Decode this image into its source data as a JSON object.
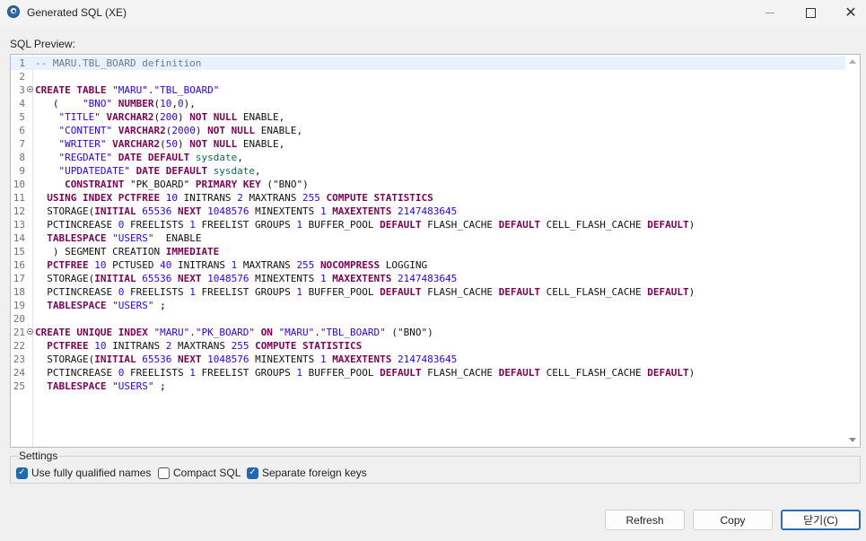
{
  "window": {
    "title": "Generated SQL (XE)"
  },
  "editor": {
    "label": "SQL Preview:",
    "lines": [
      {
        "num": "1",
        "tokens": [
          {
            "t": "-- MARU.TBL_BOARD definition",
            "c": "c"
          }
        ]
      },
      {
        "num": "2",
        "tokens": []
      },
      {
        "num": "3",
        "fold": true,
        "tokens": [
          {
            "t": "CREATE TABLE ",
            "c": "k"
          },
          {
            "t": "\"MARU\"",
            "c": "s"
          },
          {
            "t": ".",
            "c": "t"
          },
          {
            "t": "\"TBL_BOARD\"",
            "c": "s"
          }
        ]
      },
      {
        "num": "4",
        "tokens": [
          {
            "t": "   (    ",
            "c": "t"
          },
          {
            "t": "\"BNO\" ",
            "c": "s"
          },
          {
            "t": "NUMBER",
            "c": "k"
          },
          {
            "t": "(",
            "c": "t"
          },
          {
            "t": "10",
            "c": "n"
          },
          {
            "t": ",",
            "c": "t"
          },
          {
            "t": "0",
            "c": "n"
          },
          {
            "t": "),",
            "c": "t"
          }
        ]
      },
      {
        "num": "5",
        "tokens": [
          {
            "t": "    ",
            "c": "t"
          },
          {
            "t": "\"TITLE\" ",
            "c": "s"
          },
          {
            "t": "VARCHAR2",
            "c": "k"
          },
          {
            "t": "(",
            "c": "t"
          },
          {
            "t": "200",
            "c": "n"
          },
          {
            "t": ") ",
            "c": "t"
          },
          {
            "t": "NOT NULL ",
            "c": "k"
          },
          {
            "t": "ENABLE,",
            "c": "t"
          }
        ]
      },
      {
        "num": "6",
        "tokens": [
          {
            "t": "    ",
            "c": "t"
          },
          {
            "t": "\"CONTENT\" ",
            "c": "s"
          },
          {
            "t": "VARCHAR2",
            "c": "k"
          },
          {
            "t": "(",
            "c": "t"
          },
          {
            "t": "2000",
            "c": "n"
          },
          {
            "t": ") ",
            "c": "t"
          },
          {
            "t": "NOT NULL ",
            "c": "k"
          },
          {
            "t": "ENABLE,",
            "c": "t"
          }
        ]
      },
      {
        "num": "7",
        "tokens": [
          {
            "t": "    ",
            "c": "t"
          },
          {
            "t": "\"WRITER\" ",
            "c": "s"
          },
          {
            "t": "VARCHAR2",
            "c": "k"
          },
          {
            "t": "(",
            "c": "t"
          },
          {
            "t": "50",
            "c": "n"
          },
          {
            "t": ") ",
            "c": "t"
          },
          {
            "t": "NOT NULL ",
            "c": "k"
          },
          {
            "t": "ENABLE,",
            "c": "t"
          }
        ]
      },
      {
        "num": "8",
        "tokens": [
          {
            "t": "    ",
            "c": "t"
          },
          {
            "t": "\"REGDATE\" ",
            "c": "s"
          },
          {
            "t": "DATE DEFAULT ",
            "c": "k"
          },
          {
            "t": "sysdate",
            "c": "f"
          },
          {
            "t": ",",
            "c": "t"
          }
        ]
      },
      {
        "num": "9",
        "tokens": [
          {
            "t": "    ",
            "c": "t"
          },
          {
            "t": "\"UPDATEDATE\" ",
            "c": "s"
          },
          {
            "t": "DATE DEFAULT ",
            "c": "k"
          },
          {
            "t": "sysdate",
            "c": "f"
          },
          {
            "t": ",",
            "c": "t"
          }
        ]
      },
      {
        "num": "10",
        "tokens": [
          {
            "t": "     ",
            "c": "t"
          },
          {
            "t": "CONSTRAINT ",
            "c": "k"
          },
          {
            "t": "\"PK_BOARD\" ",
            "c": "t"
          },
          {
            "t": "PRIMARY KEY ",
            "c": "k"
          },
          {
            "t": "(\"BNO\")",
            "c": "t"
          }
        ]
      },
      {
        "num": "11",
        "tokens": [
          {
            "t": "  ",
            "c": "t"
          },
          {
            "t": "USING INDEX PCTFREE ",
            "c": "k"
          },
          {
            "t": "10 ",
            "c": "n"
          },
          {
            "t": "INITRANS ",
            "c": "t"
          },
          {
            "t": "2 ",
            "c": "n"
          },
          {
            "t": "MAXTRANS ",
            "c": "t"
          },
          {
            "t": "255 ",
            "c": "n"
          },
          {
            "t": "COMPUTE STATISTICS",
            "c": "k"
          }
        ]
      },
      {
        "num": "12",
        "tokens": [
          {
            "t": "  STORAGE(",
            "c": "t"
          },
          {
            "t": "INITIAL ",
            "c": "k"
          },
          {
            "t": "65536 ",
            "c": "n"
          },
          {
            "t": "NEXT ",
            "c": "k"
          },
          {
            "t": "1048576 ",
            "c": "n"
          },
          {
            "t": "MINEXTENTS ",
            "c": "t"
          },
          {
            "t": "1 ",
            "c": "n"
          },
          {
            "t": "MAXEXTENTS ",
            "c": "k"
          },
          {
            "t": "2147483645",
            "c": "n"
          }
        ]
      },
      {
        "num": "13",
        "tokens": [
          {
            "t": "  PCTINCREASE ",
            "c": "t"
          },
          {
            "t": "0 ",
            "c": "n"
          },
          {
            "t": "FREELISTS ",
            "c": "t"
          },
          {
            "t": "1 ",
            "c": "n"
          },
          {
            "t": "FREELIST GROUPS ",
            "c": "t"
          },
          {
            "t": "1 ",
            "c": "n"
          },
          {
            "t": "BUFFER_POOL ",
            "c": "t"
          },
          {
            "t": "DEFAULT ",
            "c": "k"
          },
          {
            "t": "FLASH_CACHE ",
            "c": "t"
          },
          {
            "t": "DEFAULT ",
            "c": "k"
          },
          {
            "t": "CELL_FLASH_CACHE ",
            "c": "t"
          },
          {
            "t": "DEFAULT",
            "c": "k"
          },
          {
            "t": ")",
            "c": "t"
          }
        ]
      },
      {
        "num": "14",
        "tokens": [
          {
            "t": "  ",
            "c": "t"
          },
          {
            "t": "TABLESPACE ",
            "c": "k"
          },
          {
            "t": "\"USERS\"  ",
            "c": "s"
          },
          {
            "t": "ENABLE",
            "c": "t"
          }
        ]
      },
      {
        "num": "15",
        "tokens": [
          {
            "t": "   ) SEGMENT CREATION ",
            "c": "t"
          },
          {
            "t": "IMMEDIATE",
            "c": "k"
          }
        ]
      },
      {
        "num": "16",
        "tokens": [
          {
            "t": "  ",
            "c": "t"
          },
          {
            "t": "PCTFREE ",
            "c": "k"
          },
          {
            "t": "10 ",
            "c": "n"
          },
          {
            "t": "PCTUSED ",
            "c": "t"
          },
          {
            "t": "40 ",
            "c": "n"
          },
          {
            "t": "INITRANS ",
            "c": "t"
          },
          {
            "t": "1 ",
            "c": "n"
          },
          {
            "t": "MAXTRANS ",
            "c": "t"
          },
          {
            "t": "255 ",
            "c": "n"
          },
          {
            "t": "NOCOMPRESS ",
            "c": "k"
          },
          {
            "t": "LOGGING",
            "c": "t"
          }
        ]
      },
      {
        "num": "17",
        "tokens": [
          {
            "t": "  STORAGE(",
            "c": "t"
          },
          {
            "t": "INITIAL ",
            "c": "k"
          },
          {
            "t": "65536 ",
            "c": "n"
          },
          {
            "t": "NEXT ",
            "c": "k"
          },
          {
            "t": "1048576 ",
            "c": "n"
          },
          {
            "t": "MINEXTENTS ",
            "c": "t"
          },
          {
            "t": "1 ",
            "c": "n"
          },
          {
            "t": "MAXEXTENTS ",
            "c": "k"
          },
          {
            "t": "2147483645",
            "c": "n"
          }
        ]
      },
      {
        "num": "18",
        "tokens": [
          {
            "t": "  PCTINCREASE ",
            "c": "t"
          },
          {
            "t": "0 ",
            "c": "n"
          },
          {
            "t": "FREELISTS ",
            "c": "t"
          },
          {
            "t": "1 ",
            "c": "n"
          },
          {
            "t": "FREELIST GROUPS ",
            "c": "t"
          },
          {
            "t": "1 ",
            "c": "n"
          },
          {
            "t": "BUFFER_POOL ",
            "c": "t"
          },
          {
            "t": "DEFAULT ",
            "c": "k"
          },
          {
            "t": "FLASH_CACHE ",
            "c": "t"
          },
          {
            "t": "DEFAULT ",
            "c": "k"
          },
          {
            "t": "CELL_FLASH_CACHE ",
            "c": "t"
          },
          {
            "t": "DEFAULT",
            "c": "k"
          },
          {
            "t": ")",
            "c": "t"
          }
        ]
      },
      {
        "num": "19",
        "tokens": [
          {
            "t": "  ",
            "c": "t"
          },
          {
            "t": "TABLESPACE ",
            "c": "k"
          },
          {
            "t": "\"USERS\" ",
            "c": "s"
          },
          {
            "t": ";",
            "c": "k"
          }
        ]
      },
      {
        "num": "20",
        "tokens": []
      },
      {
        "num": "21",
        "fold": true,
        "tokens": [
          {
            "t": "CREATE UNIQUE INDEX ",
            "c": "k"
          },
          {
            "t": "\"MARU\"",
            "c": "s"
          },
          {
            "t": ".",
            "c": "t"
          },
          {
            "t": "\"PK_BOARD\" ",
            "c": "s"
          },
          {
            "t": "ON ",
            "c": "k"
          },
          {
            "t": "\"MARU\"",
            "c": "s"
          },
          {
            "t": ".",
            "c": "t"
          },
          {
            "t": "\"TBL_BOARD\" ",
            "c": "s"
          },
          {
            "t": "(\"BNO\")",
            "c": "t"
          }
        ]
      },
      {
        "num": "22",
        "tokens": [
          {
            "t": "  ",
            "c": "t"
          },
          {
            "t": "PCTFREE ",
            "c": "k"
          },
          {
            "t": "10 ",
            "c": "n"
          },
          {
            "t": "INITRANS ",
            "c": "t"
          },
          {
            "t": "2 ",
            "c": "n"
          },
          {
            "t": "MAXTRANS ",
            "c": "t"
          },
          {
            "t": "255 ",
            "c": "n"
          },
          {
            "t": "COMPUTE STATISTICS",
            "c": "k"
          }
        ]
      },
      {
        "num": "23",
        "tokens": [
          {
            "t": "  STORAGE(",
            "c": "t"
          },
          {
            "t": "INITIAL ",
            "c": "k"
          },
          {
            "t": "65536 ",
            "c": "n"
          },
          {
            "t": "NEXT ",
            "c": "k"
          },
          {
            "t": "1048576 ",
            "c": "n"
          },
          {
            "t": "MINEXTENTS ",
            "c": "t"
          },
          {
            "t": "1 ",
            "c": "n"
          },
          {
            "t": "MAXEXTENTS ",
            "c": "k"
          },
          {
            "t": "2147483645",
            "c": "n"
          }
        ]
      },
      {
        "num": "24",
        "tokens": [
          {
            "t": "  PCTINCREASE ",
            "c": "t"
          },
          {
            "t": "0 ",
            "c": "n"
          },
          {
            "t": "FREELISTS ",
            "c": "t"
          },
          {
            "t": "1 ",
            "c": "n"
          },
          {
            "t": "FREELIST GROUPS ",
            "c": "t"
          },
          {
            "t": "1 ",
            "c": "n"
          },
          {
            "t": "BUFFER_POOL ",
            "c": "t"
          },
          {
            "t": "DEFAULT ",
            "c": "k"
          },
          {
            "t": "FLASH_CACHE ",
            "c": "t"
          },
          {
            "t": "DEFAULT ",
            "c": "k"
          },
          {
            "t": "CELL_FLASH_CACHE ",
            "c": "t"
          },
          {
            "t": "DEFAULT",
            "c": "k"
          },
          {
            "t": ")",
            "c": "t"
          }
        ]
      },
      {
        "num": "25",
        "tokens": [
          {
            "t": "  ",
            "c": "t"
          },
          {
            "t": "TABLESPACE ",
            "c": "k"
          },
          {
            "t": "\"USERS\" ",
            "c": "s"
          },
          {
            "t": ";",
            "c": "k"
          }
        ]
      }
    ]
  },
  "settings": {
    "label": "Settings",
    "options": [
      {
        "label": "Use fully qualified names",
        "checked": true
      },
      {
        "label": "Compact SQL",
        "checked": false
      },
      {
        "label": "Separate foreign keys",
        "checked": true
      }
    ]
  },
  "buttons": {
    "refresh": "Refresh",
    "copy": "Copy",
    "close": "닫기(C)"
  },
  "colors": {
    "keyword": "#7f0055",
    "string": "#2a00ff",
    "comment": "#6a7b8b",
    "function": "#0b6e4f",
    "accent": "#2067b5"
  }
}
